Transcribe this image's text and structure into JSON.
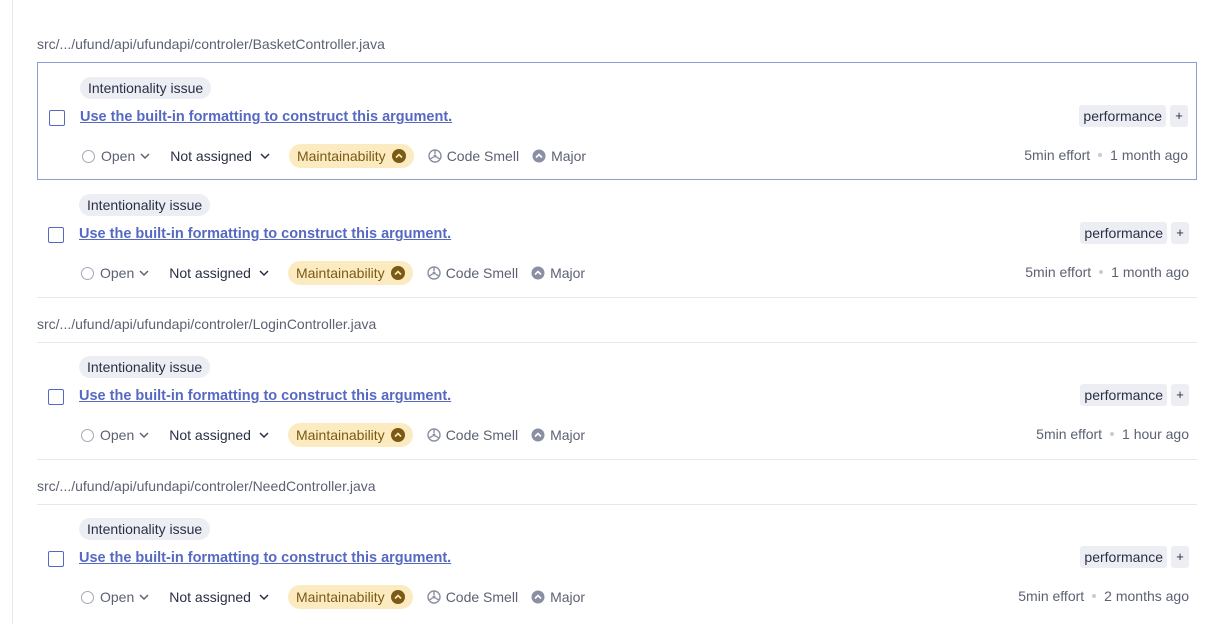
{
  "files": [
    {
      "path": "src/.../ufund/api/ufundapi/controler/BasketController.java"
    },
    {
      "path": "src/.../ufund/api/ufundapi/controler/LoginController.java"
    },
    {
      "path": "src/.../ufund/api/ufundapi/controler/NeedController.java"
    }
  ],
  "issues": [
    {
      "category": "Intentionality issue",
      "title": "Use the built-in formatting to construct this argument.",
      "tag": "performance",
      "tag_add": "+",
      "status": "Open",
      "assignee": "Not assigned",
      "quality": "Maintainability",
      "type": "Code Smell",
      "severity": "Major",
      "effort": "5min effort",
      "age": "1 month ago"
    },
    {
      "category": "Intentionality issue",
      "title": "Use the built-in formatting to construct this argument.",
      "tag": "performance",
      "tag_add": "+",
      "status": "Open",
      "assignee": "Not assigned",
      "quality": "Maintainability",
      "type": "Code Smell",
      "severity": "Major",
      "effort": "5min effort",
      "age": "1 month ago"
    },
    {
      "category": "Intentionality issue",
      "title": "Use the built-in formatting to construct this argument.",
      "tag": "performance",
      "tag_add": "+",
      "status": "Open",
      "assignee": "Not assigned",
      "quality": "Maintainability",
      "type": "Code Smell",
      "severity": "Major",
      "effort": "5min effort",
      "age": "1 hour ago"
    },
    {
      "category": "Intentionality issue",
      "title": "Use the built-in formatting to construct this argument.",
      "tag": "performance",
      "tag_add": "+",
      "status": "Open",
      "assignee": "Not assigned",
      "quality": "Maintainability",
      "type": "Code Smell",
      "severity": "Major",
      "effort": "5min effort",
      "age": "2 months ago"
    }
  ],
  "icons": {
    "status": "circle-icon",
    "dropdown": "chevron-down-icon",
    "quality_severity": "chevron-up-icon",
    "type": "code-smell-icon",
    "severity": "major-severity-icon"
  },
  "colors": {
    "link": "#5669c2",
    "badge_bg": "#fcebc1",
    "badge_text": "#7a5a14",
    "selected_border": "#8f9bd4"
  }
}
